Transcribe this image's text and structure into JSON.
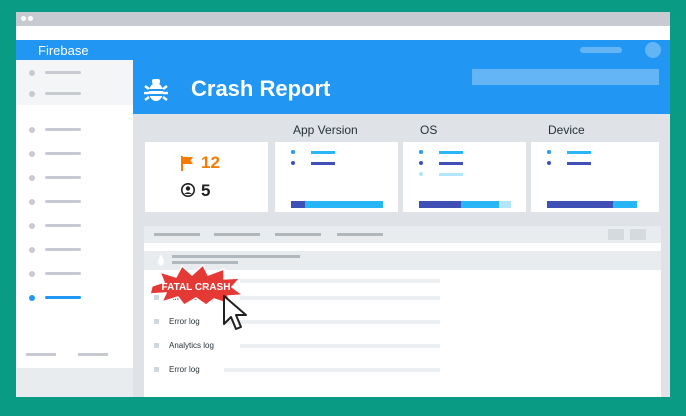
{
  "app": {
    "title": "Firebase"
  },
  "header": {
    "title": "Crash Report",
    "icon": "bug-icon"
  },
  "columns": {
    "app_version": "App Version",
    "os": "OS",
    "device": "Device"
  },
  "stats": {
    "crash_count": "12",
    "user_count": "5",
    "crash_icon": "flag-icon",
    "user_icon": "user-icon"
  },
  "badge": {
    "label": "FATAL CRASH"
  },
  "logs": [
    {
      "label": "Analytics log"
    },
    {
      "label": "Error log"
    },
    {
      "label": "Analytics log"
    },
    {
      "label": "Error log"
    }
  ],
  "colors": {
    "brand_blue": "#2196f3",
    "teal_bg": "#0a9b85",
    "accent_orange": "#f57c00",
    "alert_red": "#e53935"
  }
}
